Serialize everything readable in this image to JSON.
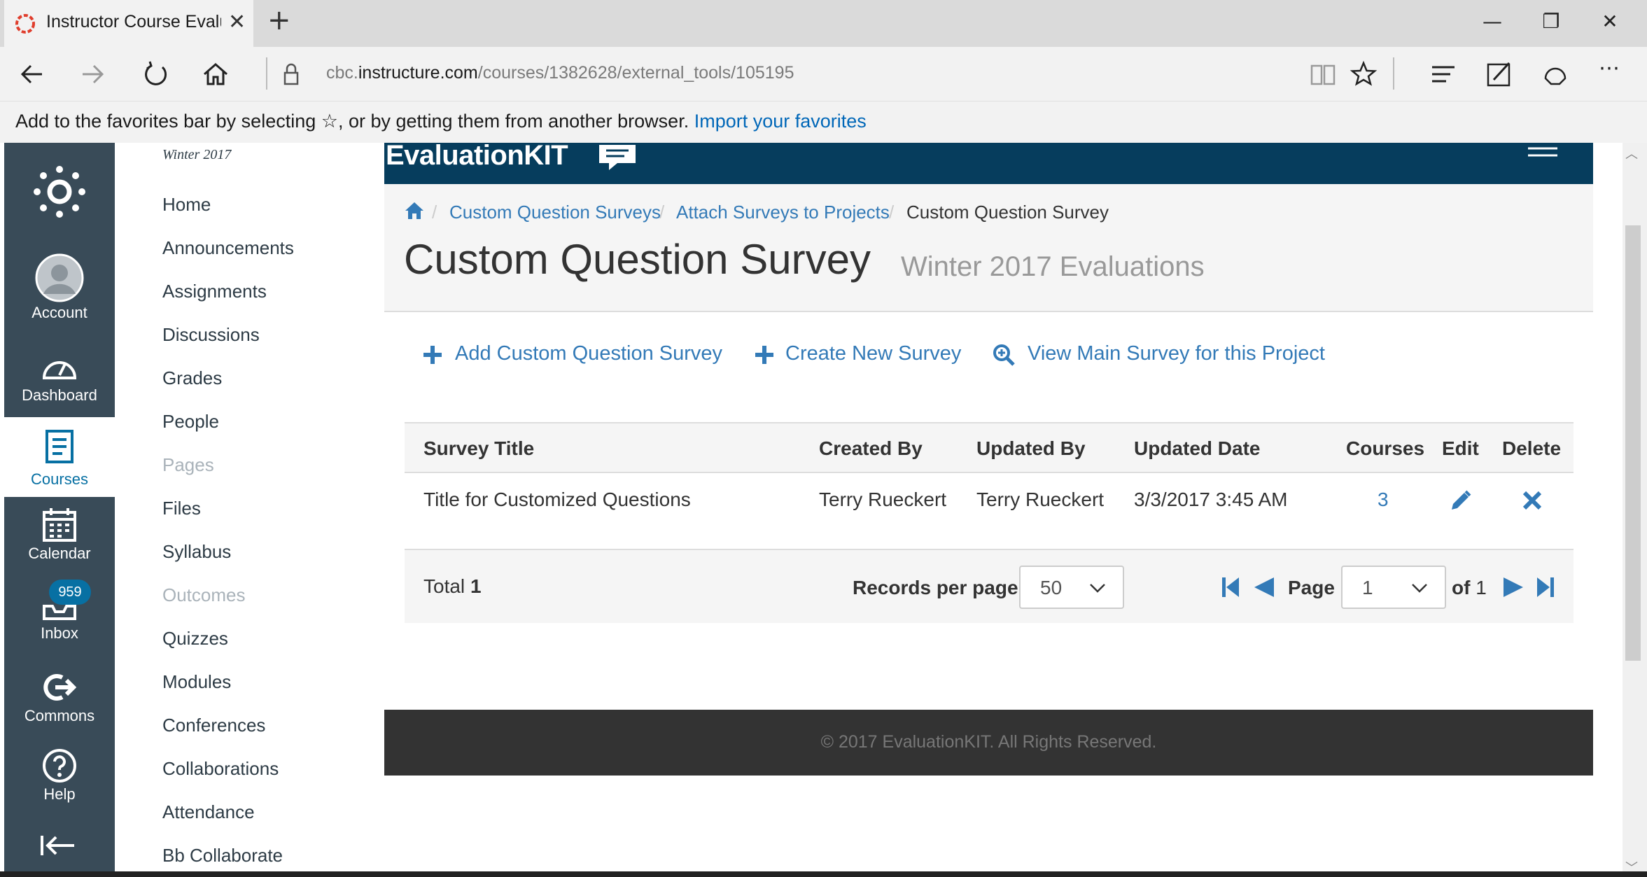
{
  "browser": {
    "tab_title": "Instructor Course Evalu",
    "url_prefix": "cbc.",
    "url_host": "instructure.com",
    "url_path": "/courses/1382628/external_tools/105195",
    "favorites_bar_text": "Add to the favorites bar by selecting ☆, or by getting them from another browser.",
    "favorites_bar_link": "Import your favorites"
  },
  "global_nav": {
    "account": "Account",
    "dashboard": "Dashboard",
    "courses": "Courses",
    "calendar": "Calendar",
    "inbox": "Inbox",
    "inbox_count": "959",
    "commons": "Commons",
    "help": "Help"
  },
  "course_nav": {
    "term": "Winter 2017",
    "items": [
      {
        "label": "Home"
      },
      {
        "label": "Announcements"
      },
      {
        "label": "Assignments"
      },
      {
        "label": "Discussions"
      },
      {
        "label": "Grades"
      },
      {
        "label": "People"
      },
      {
        "label": "Pages"
      },
      {
        "label": "Files"
      },
      {
        "label": "Syllabus"
      },
      {
        "label": "Outcomes"
      },
      {
        "label": "Quizzes"
      },
      {
        "label": "Modules"
      },
      {
        "label": "Conferences"
      },
      {
        "label": "Collaborations"
      },
      {
        "label": "Attendance"
      },
      {
        "label": "Bb Collaborate"
      }
    ]
  },
  "ek": {
    "logo": "EvaluationKIT",
    "breadcrumbs": [
      "Custom Question Surveys",
      "Attach Surveys to Projects",
      "Custom Question Survey"
    ],
    "title": "Custom Question Survey",
    "subtitle": "Winter 2017 Evaluations",
    "actions": {
      "add": "Add Custom Question Survey",
      "create": "Create New Survey",
      "view": "View Main Survey for this Project"
    },
    "table": {
      "columns": [
        "Survey Title",
        "Created By",
        "Updated By",
        "Updated Date",
        "Courses",
        "Edit",
        "Delete"
      ],
      "rows": [
        {
          "title": "Title for Customized Questions",
          "created_by": "Terry Rueckert",
          "updated_by": "Terry Rueckert",
          "updated_date": "3/3/2017 3:45 AM",
          "courses": "3"
        }
      ]
    },
    "footer_bar": {
      "total_label": "Total",
      "total_value": "1",
      "records_label": "Records per page",
      "records_value": "50",
      "page_label": "Page",
      "page_value": "1",
      "of_label": "of",
      "of_value": "1"
    },
    "copyright": "© 2017 EvaluationKIT. All Rights Reserved."
  },
  "colors": {
    "canvas_nav": "#394b58",
    "canvas_blue": "#0770a3",
    "ek_header": "#063d5d",
    "link_blue": "#337ab7",
    "footer": "#333333"
  }
}
